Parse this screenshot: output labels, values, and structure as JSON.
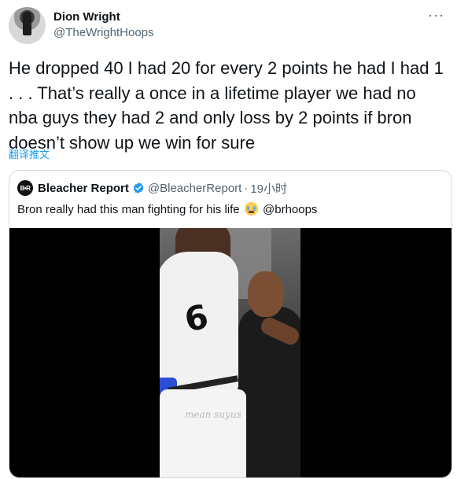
{
  "tweet": {
    "author": {
      "display_name": "Dion Wright",
      "handle": "@TheWrightHoops"
    },
    "more_icon": "more-dots-icon",
    "text": "He dropped 40 I had 20 for every 2 points he had I had 1 . . . That’s really a once in a lifetime player we had no nba guys they had 2 and only loss by 2 points if bron doesn’t show up we win for sure",
    "translate_label": "翻译推文"
  },
  "quote": {
    "logo_text": "B•R",
    "display_name": "Bleacher Report",
    "verified_icon": "verified-badge-icon",
    "handle": "@BleacherReport",
    "separator": "·",
    "time": "19小时",
    "text_before_emoji": "Bron really had this man fighting for his life",
    "emoji": "loudly-crying-face-emoji",
    "text_after_emoji": "@brhoops",
    "media": {
      "jersey_number": "6",
      "watermark": "mean\nsuyus"
    }
  },
  "colors": {
    "text_primary": "#0f1419",
    "text_secondary": "#536471",
    "link": "#1d9bf0",
    "border": "#cfd9de",
    "verified": "#1d9bf0"
  }
}
